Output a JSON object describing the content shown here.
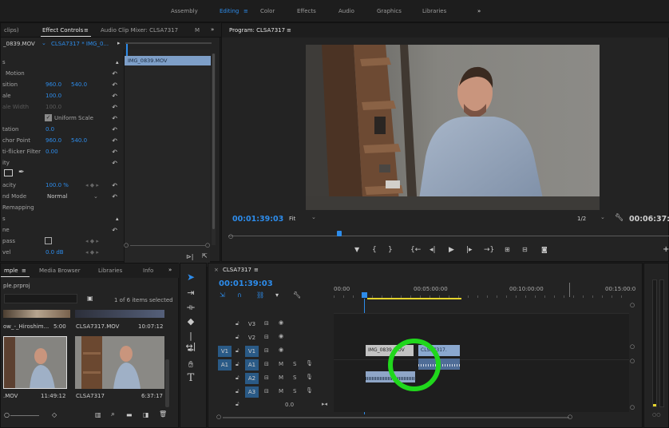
{
  "workspaces": [
    "Assembly",
    "Editing",
    "Color",
    "Effects",
    "Audio",
    "Graphics",
    "Libraries"
  ],
  "workspaces_more": "»",
  "effect_controls": {
    "tab_partial": "clips)",
    "tab_active": "Effect Controls",
    "tab_menu": "≡",
    "tab_audio": "Audio Clip Mixer: CLSA7317",
    "tab_m": "M",
    "tab_more": "»",
    "source_clip": "_0839.MOV",
    "target_clip": "CLSA7317 * IMG_0...",
    "timeline_clip": "IMG_0839.MOV",
    "rows": {
      "fx": "s",
      "motion": "Motion",
      "position_label": "sition",
      "position_x": "960.0",
      "position_y": "540.0",
      "scale_label": "ale",
      "scale_val": "100.0",
      "scalew_label": "ale Width",
      "scalew_val": "100.0",
      "uniform": "Uniform Scale",
      "rotation_label": "tation",
      "rotation_val": "0.0",
      "anchor_label": "chor Point",
      "anchor_x": "960.0",
      "anchor_y": "540.0",
      "flicker_label": "ti-flicker Filter",
      "flicker_val": "0.00",
      "opacity_header": "ity",
      "opacity_label": "acity",
      "opacity_val": "100.0 %",
      "blend_label": "nd Mode",
      "blend_val": "Normal",
      "remap": "Remapping",
      "s2": "s",
      "ne": "ne",
      "pass": "pass",
      "vel": "vel",
      "vel_val": "0.0 dB"
    }
  },
  "program": {
    "title": "Program: CLSA7317",
    "menu": "≡",
    "timecode": "00:01:39:03",
    "fit": "Fit",
    "quality": "1/2",
    "duration": "00:06:37:17"
  },
  "project": {
    "tab_partial": "mple",
    "tab_menu": "≡",
    "tab_media": "Media Browser",
    "tab_libraries": "Libraries",
    "tab_info": "Info",
    "tab_more": "»",
    "file": "ple.prproj",
    "selection": "1 of 6 items selected",
    "items": [
      {
        "name": "ow_-_Hiroshim...",
        "dur": "5:00"
      },
      {
        "name": "CLSA7317.MOV",
        "dur": "10:07:12"
      },
      {
        "name": ".MOV",
        "dur": "11:49:12"
      },
      {
        "name": "CLSA7317",
        "dur": "6:37:17"
      }
    ]
  },
  "timeline": {
    "tab_close": "×",
    "tab": "CLSA7317",
    "tab_menu": "≡",
    "timecode": "00:01:39:03",
    "ruler": [
      "00:00",
      "00:05:00:00",
      "00:10:00:00",
      "00:15:00:0"
    ],
    "tracks": [
      {
        "id": "V3",
        "src": ""
      },
      {
        "id": "V2",
        "src": ""
      },
      {
        "id": "V1",
        "src": "V1"
      },
      {
        "id": "A1",
        "src": "A1"
      },
      {
        "id": "A2",
        "src": ""
      },
      {
        "id": "A3",
        "src": ""
      }
    ],
    "master_val": "0.0",
    "clip_v1_a": "IMG_0839.MOV",
    "clip_v1_b": "CLSA7317.",
    "track_m": "M",
    "track_s": "S"
  },
  "colors": {
    "accent": "#2d8ceb",
    "highlight_circle": "#20d71c",
    "video_clip": "#c3c3c3",
    "audio_clip": "#8fa6c7",
    "workarea": "#e4d42d"
  }
}
